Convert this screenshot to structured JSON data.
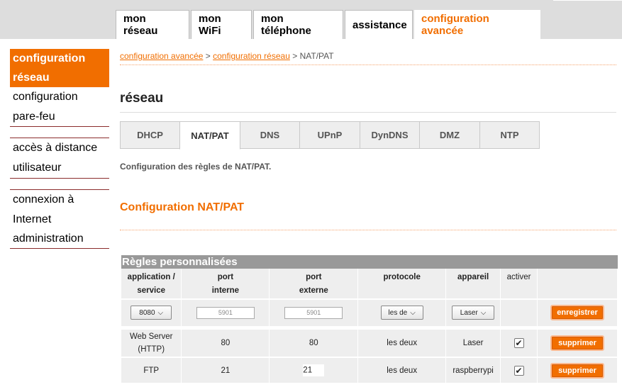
{
  "topnav": [
    {
      "label": "mon réseau"
    },
    {
      "label": "mon WiFi"
    },
    {
      "label": "mon téléphone"
    },
    {
      "label": "assistance"
    },
    {
      "label": "configuration avancée"
    }
  ],
  "sidebar": {
    "items": [
      {
        "label": "configuration réseau"
      },
      {
        "label": "configuration pare-feu"
      },
      {
        "label": "accès à distance utilisateur"
      },
      {
        "label": "connexion à Internet"
      },
      {
        "label": "administration"
      }
    ]
  },
  "breadcrumb": {
    "link1": "configuration avancée",
    "link2": "configuration réseau",
    "sep": ">",
    "current": "NAT/PAT"
  },
  "section_title": "réseau",
  "subtabs": [
    "DHCP",
    "NAT/PAT",
    "DNS",
    "UPnP",
    "DynDNS",
    "DMZ",
    "NTP"
  ],
  "description": "Configuration des règles de NAT/PAT.",
  "subtitle": "Configuration NAT/PAT",
  "table": {
    "title": "Règles personnalisées",
    "headers": {
      "app_1": "application /",
      "app_2": "service",
      "pint_1": "port",
      "pint_2": "interne",
      "pext_1": "port",
      "pext_2": "externe",
      "protocol": "protocole",
      "device": "appareil",
      "activate": "activer"
    },
    "input_row": {
      "app_value": "8080",
      "port_int_placeholder": "5901",
      "port_ext_placeholder": "5901",
      "protocol_value": "les de",
      "device_value": "Laser",
      "save_label": "enregistrer"
    },
    "rows": [
      {
        "service_1": "Web Server",
        "service_2": "(HTTP)",
        "port_int": "80",
        "port_ext": "80",
        "protocol": "les deux",
        "device": "Laser",
        "delete_label": "supprimer"
      },
      {
        "service_1": "FTP",
        "service_2": "",
        "port_int": "21",
        "port_ext": "21",
        "protocol": "les deux",
        "device": "raspberrypi",
        "delete_label": "supprimer"
      }
    ]
  },
  "colors": {
    "accent": "#f16e00",
    "nav_band": "#dddddd",
    "table_title_bg": "#999999"
  }
}
